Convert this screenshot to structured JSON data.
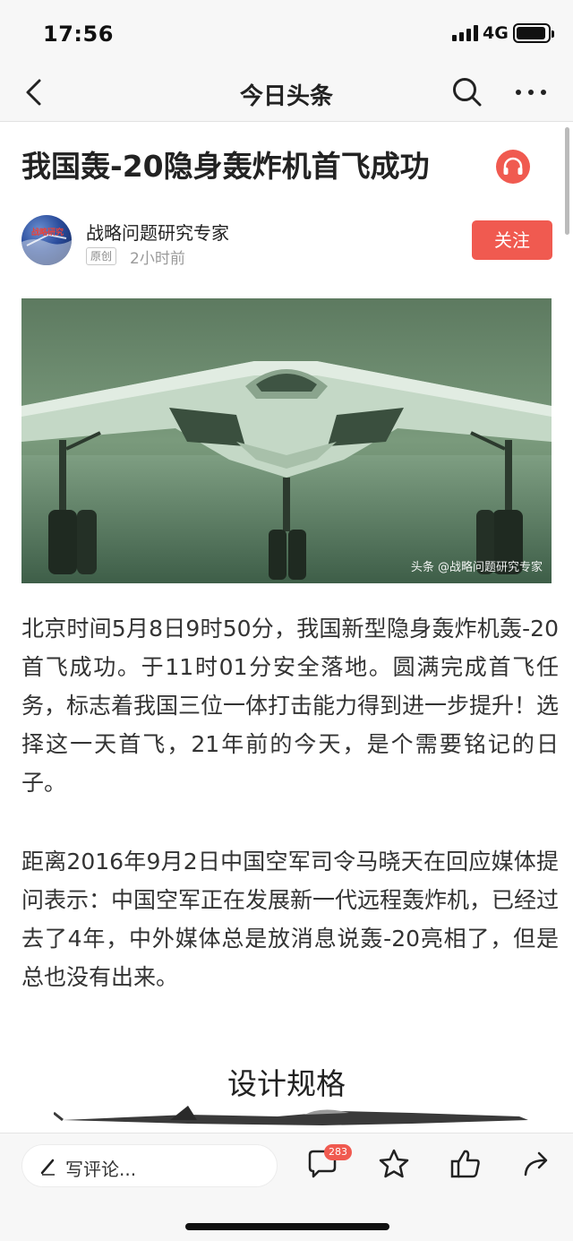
{
  "status_bar": {
    "time": "17:56",
    "network": "4G",
    "battery_level": 0.95
  },
  "nav": {
    "title": "今日头条",
    "icons": [
      "back-arrow-icon",
      "search-icon",
      "more-dots-icon"
    ]
  },
  "article": {
    "title": "我国轰-20隐身轰炸机首飞成功",
    "author": {
      "name": "战略问题研究专家",
      "badge": "原创",
      "time": "2小时前",
      "follow_label": "关注",
      "avatar_text": "战略研究"
    },
    "image": {
      "watermark": "头条 @战略问题研究专家"
    },
    "paragraphs": [
      "北京时间5月8日9时50分，我国新型隐身轰炸机轰-20首飞成功。于11时01分安全落地。圆满完成首飞任务，标志着我国三位一体打击能力得到进一步提升！选择这一天首飞，21年前的今天，是个需要铭记的日子。",
      "距离2016年9月2日中国空军司令马晓天在回应媒体提问表示：中国空军正在发展新一代远程轰炸机，已经过去了4年，中外媒体总是放消息说轰-20亮相了，但是总也没有出来。"
    ],
    "figure_title": "设计规格"
  },
  "bottom_bar": {
    "comment_placeholder": "写评论...",
    "comment_count": "283",
    "icons": [
      "comment-icon",
      "star-icon",
      "like-icon",
      "share-icon"
    ]
  },
  "colors": {
    "accent": "#f05a50",
    "bar_bg": "#f7f7f7",
    "text": "#333333"
  }
}
